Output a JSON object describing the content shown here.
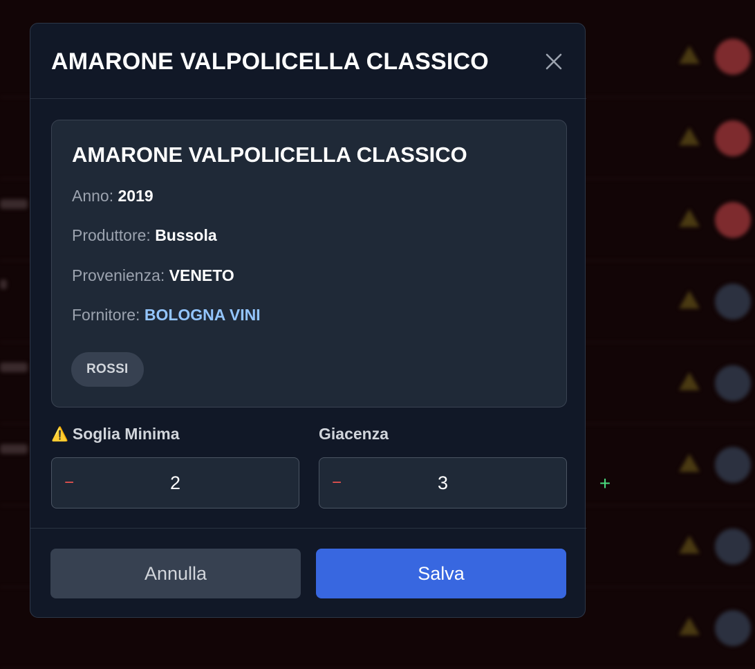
{
  "modal": {
    "title": "AMARONE VALPOLICELLA CLASSICO",
    "close_icon": "close-icon"
  },
  "card": {
    "title": "AMARONE VALPOLICELLA CLASSICO",
    "anno_label": "Anno:",
    "anno_value": "2019",
    "produttore_label": "Produttore:",
    "produttore_value": "Bussola",
    "provenienza_label": "Provenienza:",
    "provenienza_value": "VENETO",
    "fornitore_label": "Fornitore:",
    "fornitore_value": "BOLOGNA VINI",
    "tag": "ROSSI"
  },
  "soglia": {
    "icon": "⚠️",
    "label": "Soglia Minima",
    "minus": "−",
    "value": "2"
  },
  "giacenza": {
    "label": "Giacenza",
    "minus": "−",
    "value": "3",
    "plus": "+"
  },
  "actions": {
    "cancel_label": "Annulla",
    "save_label": "Salva"
  },
  "colors": {
    "accent": "#3867e0",
    "link": "#93c5fd",
    "minus": "#ef5350",
    "plus": "#4ade80"
  }
}
